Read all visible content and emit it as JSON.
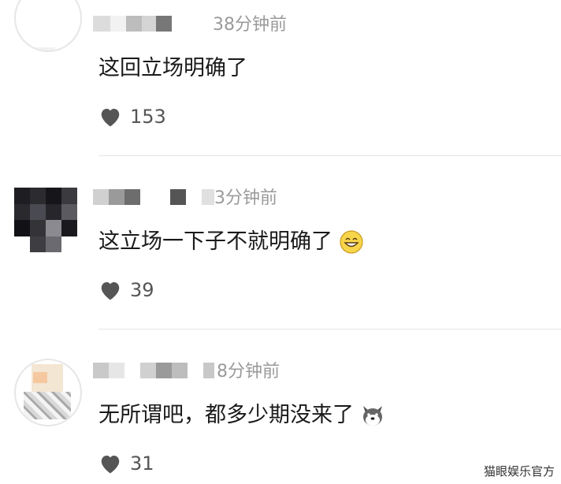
{
  "comments": [
    {
      "time": "38分钟前",
      "text": "这回立场明确了",
      "likes": "153",
      "emoji": ""
    },
    {
      "time": "3分钟前",
      "text": "这立场一下子不就明确了",
      "likes": "39",
      "emoji": "grinning-face"
    },
    {
      "time": "8分钟前",
      "text": "无所谓吧，都多少期没来了",
      "likes": "31",
      "emoji": "dog-face"
    }
  ],
  "watermark": "猫眼娱乐官方",
  "colors": {
    "like_icon": "#555555",
    "time_text": "#9a9a9a"
  }
}
